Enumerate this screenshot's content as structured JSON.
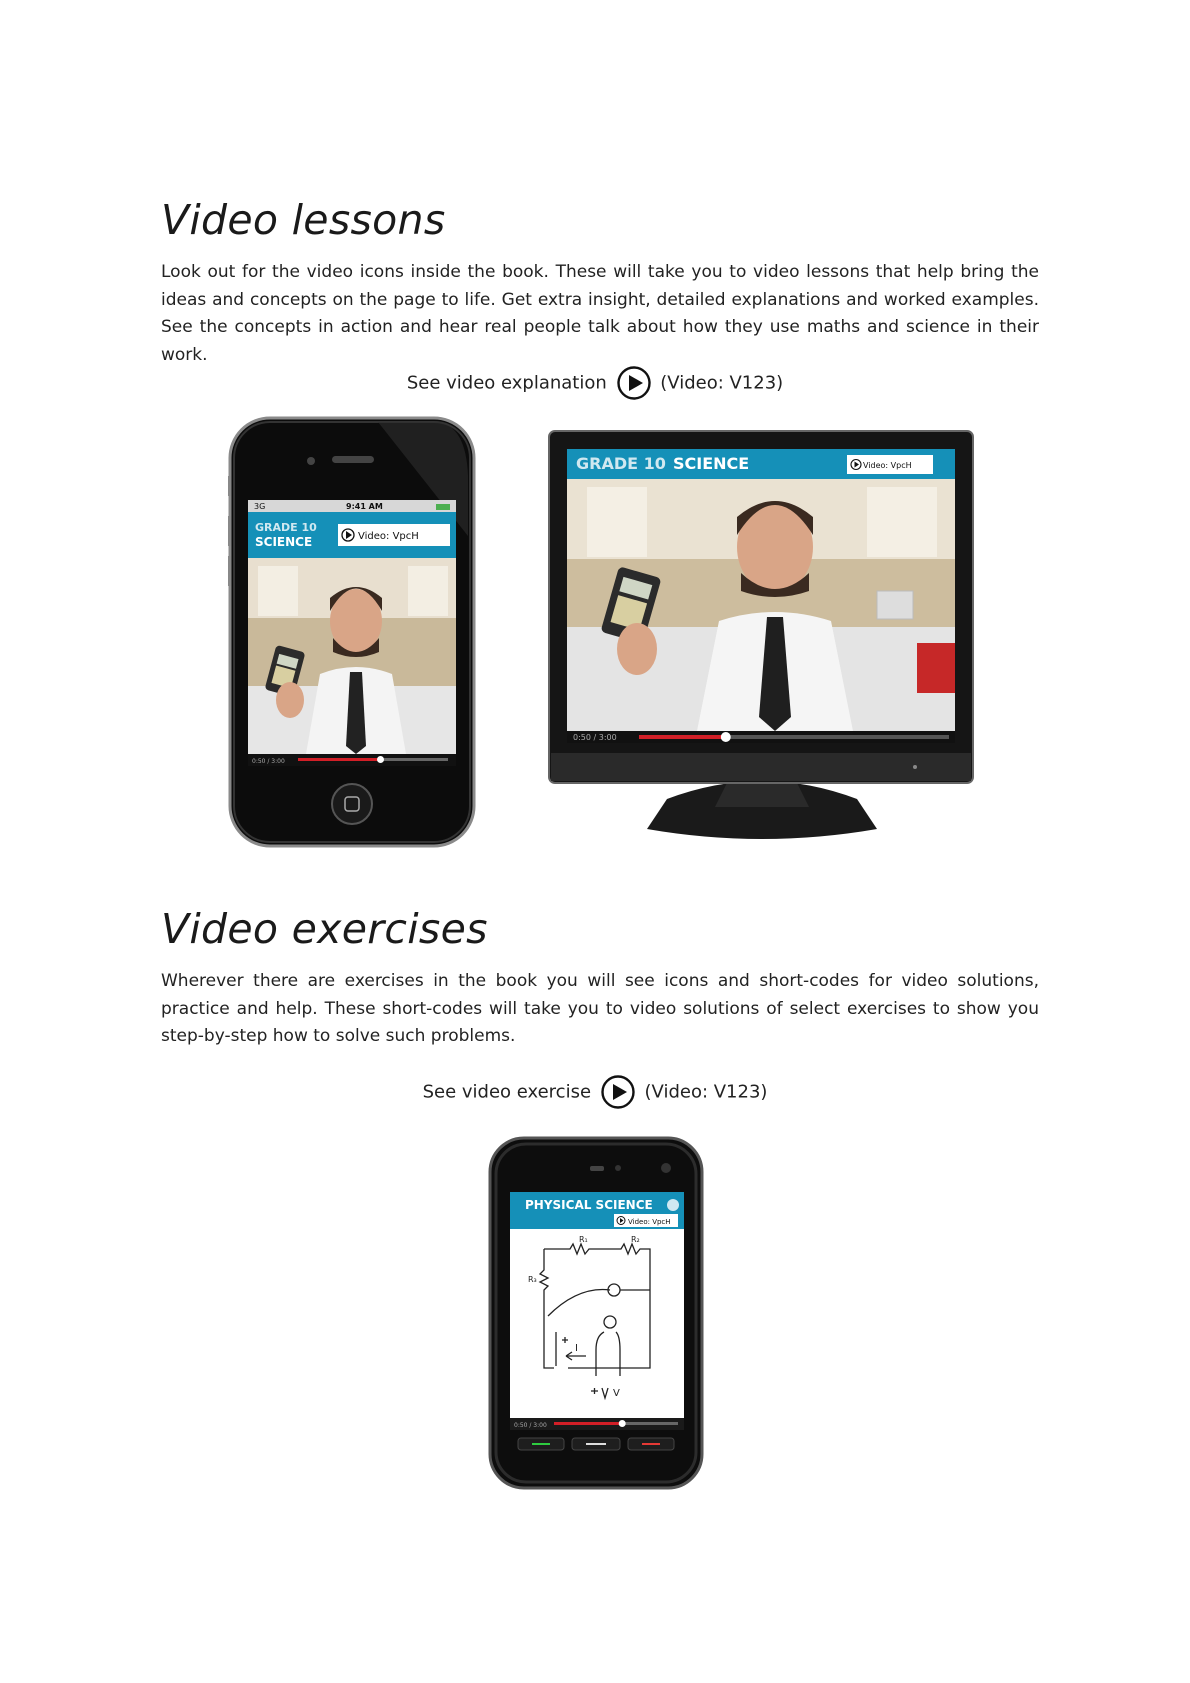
{
  "lessons": {
    "heading": "Video lessons",
    "paragraph": "Look out for the video icons inside the book. These will take you to video lessons that help bring the ideas and concepts on the page to life. Get extra insight, detailed explanations and worked examples. See the concepts in action and hear real people talk about how they use maths and science in their work.",
    "link_text": "See video explanation",
    "video_code": "(Video: V123)"
  },
  "phone": {
    "carrier": "3G",
    "time": "9:41 AM",
    "banner_line1": "GRADE 10",
    "banner_line2": "SCIENCE",
    "video_tag": "Video: VpcH",
    "timecode": "0:50 / 3:00",
    "progress": 0.55
  },
  "monitor": {
    "banner_grade": "GRADE 10",
    "banner_subject": "SCIENCE",
    "video_tag": "Video: VpcH",
    "timecode": "0:50 / 3:00",
    "progress": 0.28
  },
  "exercises": {
    "heading": "Video exercises",
    "paragraph": "Wherever there are exercises in the book you will see icons and short-codes for video solutions, practice and help. These short-codes will take you to video solutions of select exercises to show you step-by-step how to solve such problems.",
    "link_text": "See video exercise",
    "video_code": "(Video: V123)"
  },
  "smartphone": {
    "banner": "PHYSICAL SCIENCE",
    "video_tag": "Video: VpcH",
    "timecode": "0:50 / 3:00",
    "progress": 0.55,
    "diagram_labels": {
      "r1": "R₁",
      "r2": "R₂",
      "r3": "R₃",
      "current": "I",
      "voltage": "V"
    }
  },
  "colors": {
    "banner_blue": "#1590b8",
    "progress_red": "#d21f27"
  }
}
